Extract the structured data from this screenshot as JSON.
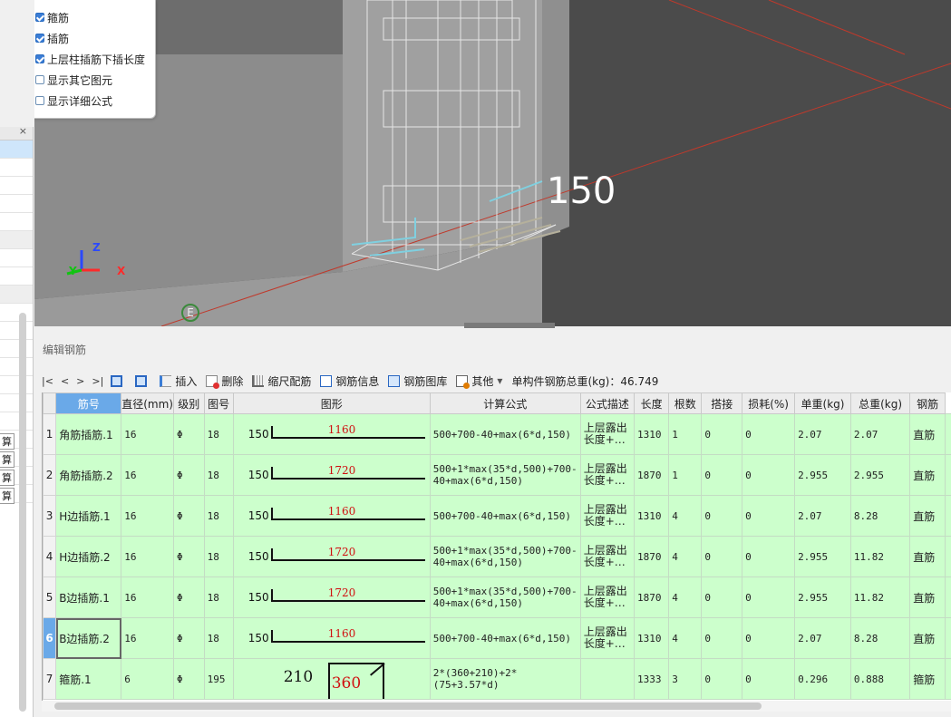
{
  "left_panel": {
    "close_glyph": "×",
    "rows": [
      {
        "text": "",
        "state": "sel"
      },
      {
        "text": "",
        "state": ""
      },
      {
        "text": "",
        "state": ""
      },
      {
        "text": "",
        "state": ""
      },
      {
        "text": "",
        "state": ""
      },
      {
        "text": "",
        "state": "gray"
      },
      {
        "text": "",
        "state": ""
      },
      {
        "text": "",
        "state": ""
      },
      {
        "text": "",
        "state": "gray"
      },
      {
        "text": "",
        "state": ""
      },
      {
        "text": "",
        "state": ""
      },
      {
        "text": "",
        "state": ""
      },
      {
        "text": "",
        "state": ""
      },
      {
        "text": "",
        "state": ""
      },
      {
        "text": "",
        "state": ""
      },
      {
        "text": "",
        "state": ""
      },
      {
        "text": "算",
        "state": ""
      },
      {
        "text": "算",
        "state": ""
      },
      {
        "text": "算",
        "state": ""
      },
      {
        "text": "算",
        "state": ""
      }
    ]
  },
  "viewport": {
    "dimension_label": "150",
    "axis_z": "Z",
    "axis_y": "Y",
    "axis_x": "X",
    "compass_label": "E"
  },
  "display_options": {
    "items": [
      {
        "label": "箍筋",
        "checked": true
      },
      {
        "label": "插筋",
        "checked": true
      },
      {
        "label": "上层柱插筋下插长度",
        "checked": true
      },
      {
        "label": "显示其它图元",
        "checked": false
      },
      {
        "label": "显示详细公式",
        "checked": false
      }
    ]
  },
  "panel": {
    "title": "编辑钢筋"
  },
  "toolbar": {
    "nav_first": "|<",
    "nav_prev": "<",
    "nav_next": ">",
    "nav_last": ">|",
    "insert": "插入",
    "delete": "删除",
    "scale_rebar": "缩尺配筋",
    "rebar_info": "钢筋信息",
    "rebar_library": "钢筋图库",
    "other": "其他",
    "other_arrow": "▾",
    "total_weight_label": "单构件钢筋总重(kg)：46.749"
  },
  "table": {
    "columns": [
      "筋号",
      "直径(mm)",
      "级别",
      "图号",
      "图形",
      "计算公式",
      "公式描述",
      "长度",
      "根数",
      "搭接",
      "损耗(%)",
      "单重(kg)",
      "总重(kg)",
      "钢筋"
    ],
    "rows": [
      {
        "no": "1",
        "name": "角筋插筋.1",
        "dia": "16",
        "grade": "Φ",
        "fig": "18",
        "shape_left": "150",
        "shape_mid": "1160",
        "formula": "500+700-40+max(6*d,150)",
        "desc": "上层露出长度+…",
        "length": "1310",
        "count": "1",
        "lap": "0",
        "loss": "0",
        "unit_wt": "2.07",
        "total_wt": "2.07",
        "type": "直筋"
      },
      {
        "no": "2",
        "name": "角筋插筋.2",
        "dia": "16",
        "grade": "Φ",
        "fig": "18",
        "shape_left": "150",
        "shape_mid": "1720",
        "formula": "500+1*max(35*d,500)+700-40+max(6*d,150)",
        "desc": "上层露出长度+…",
        "length": "1870",
        "count": "1",
        "lap": "0",
        "loss": "0",
        "unit_wt": "2.955",
        "total_wt": "2.955",
        "type": "直筋"
      },
      {
        "no": "3",
        "name": "H边插筋.1",
        "dia": "16",
        "grade": "Φ",
        "fig": "18",
        "shape_left": "150",
        "shape_mid": "1160",
        "formula": "500+700-40+max(6*d,150)",
        "desc": "上层露出长度+…",
        "length": "1310",
        "count": "4",
        "lap": "0",
        "loss": "0",
        "unit_wt": "2.07",
        "total_wt": "8.28",
        "type": "直筋"
      },
      {
        "no": "4",
        "name": "H边插筋.2",
        "dia": "16",
        "grade": "Φ",
        "fig": "18",
        "shape_left": "150",
        "shape_mid": "1720",
        "formula": "500+1*max(35*d,500)+700-40+max(6*d,150)",
        "desc": "上层露出长度+…",
        "length": "1870",
        "count": "4",
        "lap": "0",
        "loss": "0",
        "unit_wt": "2.955",
        "total_wt": "11.82",
        "type": "直筋"
      },
      {
        "no": "5",
        "name": "B边插筋.1",
        "dia": "16",
        "grade": "Φ",
        "fig": "18",
        "shape_left": "150",
        "shape_mid": "1720",
        "formula": "500+1*max(35*d,500)+700-40+max(6*d,150)",
        "desc": "上层露出长度+…",
        "length": "1870",
        "count": "4",
        "lap": "0",
        "loss": "0",
        "unit_wt": "2.955",
        "total_wt": "11.82",
        "type": "直筋"
      },
      {
        "no": "6",
        "name": "B边插筋.2",
        "dia": "16",
        "grade": "Φ",
        "fig": "18",
        "shape_left": "150",
        "shape_mid": "1160",
        "formula": "500+700-40+max(6*d,150)",
        "desc": "上层露出长度+…",
        "length": "1310",
        "count": "4",
        "lap": "0",
        "loss": "0",
        "unit_wt": "2.07",
        "total_wt": "8.28",
        "type": "直筋"
      },
      {
        "no": "7",
        "name": "箍筋.1",
        "dia": "6",
        "grade": "Φ",
        "fig": "195",
        "shape_left": "210",
        "shape_mid": "360",
        "formula": "2*(360+210)+2*(75+3.57*d)",
        "desc": "",
        "length": "1333",
        "count": "3",
        "lap": "0",
        "loss": "0",
        "unit_wt": "0.296",
        "total_wt": "0.888",
        "type": "箍筋"
      }
    ],
    "selected_row_index": 5
  }
}
